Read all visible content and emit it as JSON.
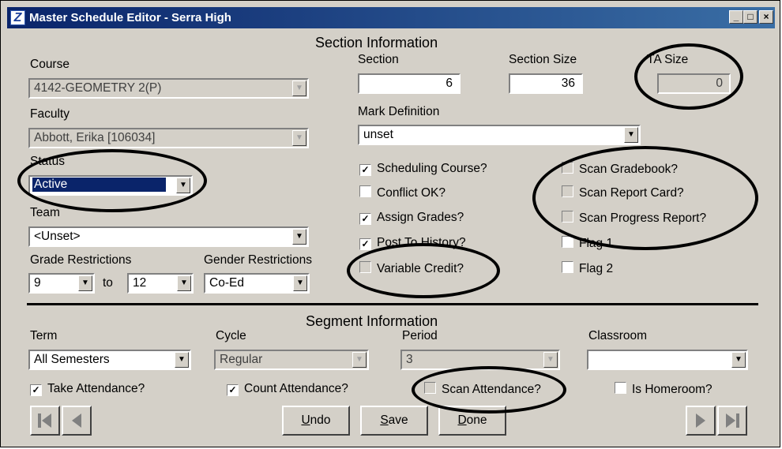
{
  "window": {
    "title": "Master Schedule Editor - Serra High",
    "controls": [
      "minimize-icon",
      "maximize-icon",
      "close-icon"
    ]
  },
  "section_info": {
    "header": "Section Information",
    "course": {
      "label": "Course",
      "value": "4142-GEOMETRY 2(P)"
    },
    "faculty": {
      "label": "Faculty",
      "value": "Abbott, Erika [106034]"
    },
    "status": {
      "label": "Status",
      "value": "Active"
    },
    "team": {
      "label": "Team",
      "value": "<Unset>"
    },
    "grade_restrictions": {
      "label": "Grade Restrictions",
      "from": "9",
      "to_label": "to",
      "to": "12"
    },
    "gender_restrictions": {
      "label": "Gender Restrictions",
      "value": "Co-Ed"
    },
    "section": {
      "label": "Section",
      "value": "6"
    },
    "section_size": {
      "label": "Section Size",
      "value": "36"
    },
    "ta_size": {
      "label": "TA Size",
      "value": "0"
    },
    "mark_definition": {
      "label": "Mark Definition",
      "value": "unset"
    },
    "checkboxes_left": [
      {
        "label": "Scheduling Course?",
        "checked": true
      },
      {
        "label": "Conflict OK?",
        "checked": false
      },
      {
        "label": "Assign Grades?",
        "checked": true
      },
      {
        "label": "Post To History?",
        "checked": true
      },
      {
        "label": "Variable Credit?",
        "checked": false
      }
    ],
    "checkboxes_right": [
      {
        "label": "Scan Gradebook?",
        "checked": false
      },
      {
        "label": "Scan Report Card?",
        "checked": false
      },
      {
        "label": "Scan Progress Report?",
        "checked": false
      },
      {
        "label": "Flag 1",
        "checked": false
      },
      {
        "label": "Flag 2",
        "checked": false
      }
    ]
  },
  "segment_info": {
    "header": "Segment Information",
    "term": {
      "label": "Term",
      "value": "All Semesters"
    },
    "cycle": {
      "label": "Cycle",
      "value": "Regular"
    },
    "period": {
      "label": "Period",
      "value": "3"
    },
    "classroom": {
      "label": "Classroom",
      "value": ""
    },
    "take_attendance": {
      "label": "Take Attendance?",
      "checked": true
    },
    "count_attendance": {
      "label": "Count Attendance?",
      "checked": true
    },
    "scan_attendance": {
      "label": "Scan Attendance?",
      "checked": false
    },
    "is_homeroom": {
      "label": "Is Homeroom?",
      "checked": false
    }
  },
  "buttons": {
    "undo": {
      "mnemonic": "U",
      "rest": "ndo"
    },
    "save": {
      "mnemonic": "S",
      "rest": "ave"
    },
    "done": {
      "mnemonic": "D",
      "rest": "one"
    }
  },
  "nav_icons": [
    "first-record-icon",
    "previous-record-icon",
    "next-record-icon",
    "last-record-icon"
  ]
}
